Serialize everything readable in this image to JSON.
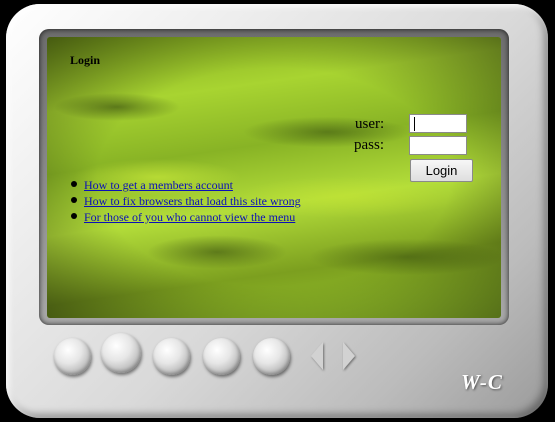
{
  "heading": "Login",
  "form": {
    "user_label": "user:",
    "pass_label": "pass:",
    "user_value": "",
    "pass_value": "",
    "submit_label": "Login"
  },
  "help_links": [
    "How to get a members account",
    "How to fix browsers that load this site wrong",
    "For those of you who cannot view the menu"
  ],
  "controls": {
    "buttons": [
      "round-button-1",
      "round-button-2",
      "round-button-3",
      "round-button-4",
      "round-button-5"
    ],
    "prev_icon": "left-triangle-arrow",
    "next_icon": "right-triangle-arrow"
  },
  "logo_text": "W-C",
  "colors": {
    "screen_green": "#a8d431",
    "link_blue": "#0b10b8",
    "frame_silver": "#d9d9d9"
  }
}
